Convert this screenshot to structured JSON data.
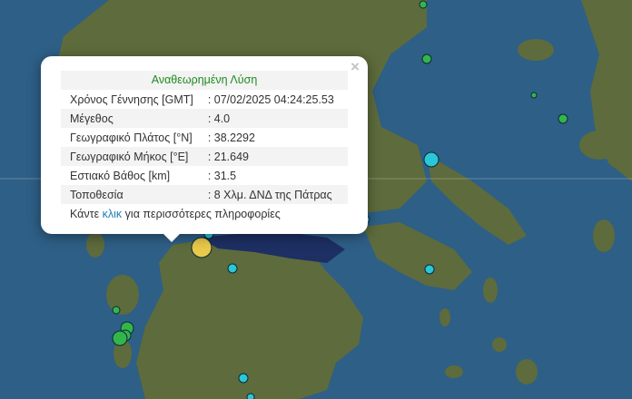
{
  "popup": {
    "title": "Αναθεωρημένη Λύση",
    "close_label": "×",
    "rows": [
      {
        "label": "Χρόνος Γέννησης [GMT]",
        "value": ": 07/02/2025 04:24:25.53"
      },
      {
        "label": "Μέγεθος",
        "value": ": 4.0"
      },
      {
        "label": "Γεωγραφικό Πλάτος [°N]",
        "value": ": 38.2292"
      },
      {
        "label": "Γεωγραφικό Μήκος [°E]",
        "value": ": 21.649"
      },
      {
        "label": "Εστιακό Βάθος [km]",
        "value": ": 31.5"
      },
      {
        "label": "Τοποθεσία",
        "value": ": 8 Χλμ. ΔΝΔ της Πάτρας"
      }
    ],
    "more_prefix": "Κάντε ",
    "more_link": "κλικ",
    "more_suffix": " για περισσότερες πληροφορίες"
  },
  "colors": {
    "sea": "#2e5f86",
    "land": "#5e6b3c",
    "land_dark": "#4a5530",
    "gulf": "#1d2f63",
    "quake_green": "#33b54a",
    "quake_cyan": "#2ac7d6",
    "quake_yellow": "#e9c94a",
    "accent_green": "#1f8a1f",
    "link_blue": "#1a7fb5"
  }
}
